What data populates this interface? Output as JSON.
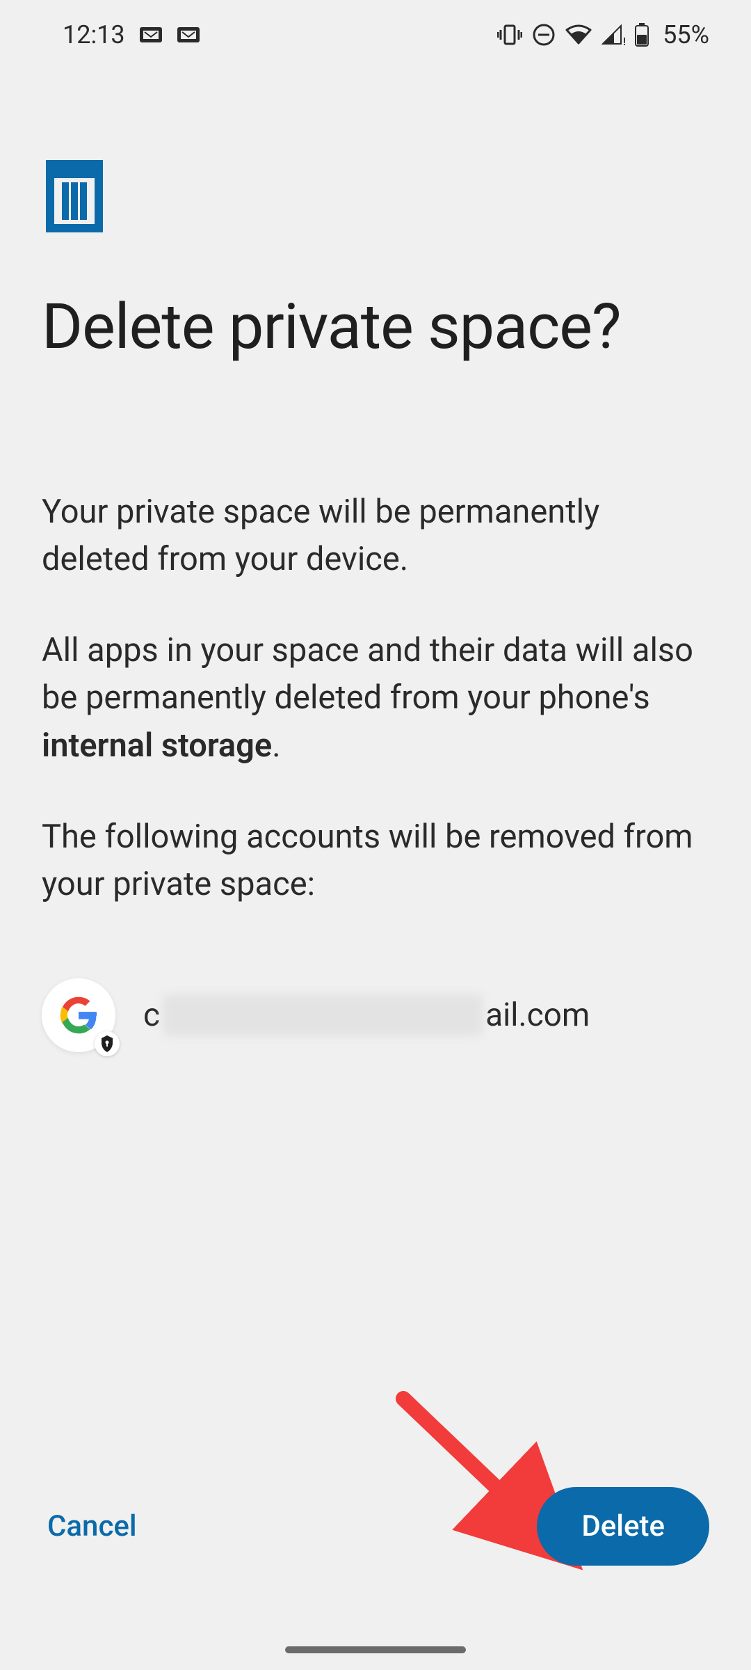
{
  "status_bar": {
    "time": "12:13",
    "battery_percent": "55%"
  },
  "header": {
    "title": "Delete private space?"
  },
  "body": {
    "p1": "Your private space will be permanently deleted from your device.",
    "p2a": "All apps in your space and their data will also be permanently deleted from your phone's ",
    "p2b_bold": "internal storage",
    "p2c": ".",
    "p3": "The following accounts will be removed from your private space:"
  },
  "account": {
    "prefix": "c",
    "suffix": "ail.com"
  },
  "footer": {
    "cancel_label": "Cancel",
    "delete_label": "Delete"
  },
  "colors": {
    "accent": "#0b6aa9",
    "bg": "#f0f0f0",
    "annotation": "#f23b3b"
  }
}
